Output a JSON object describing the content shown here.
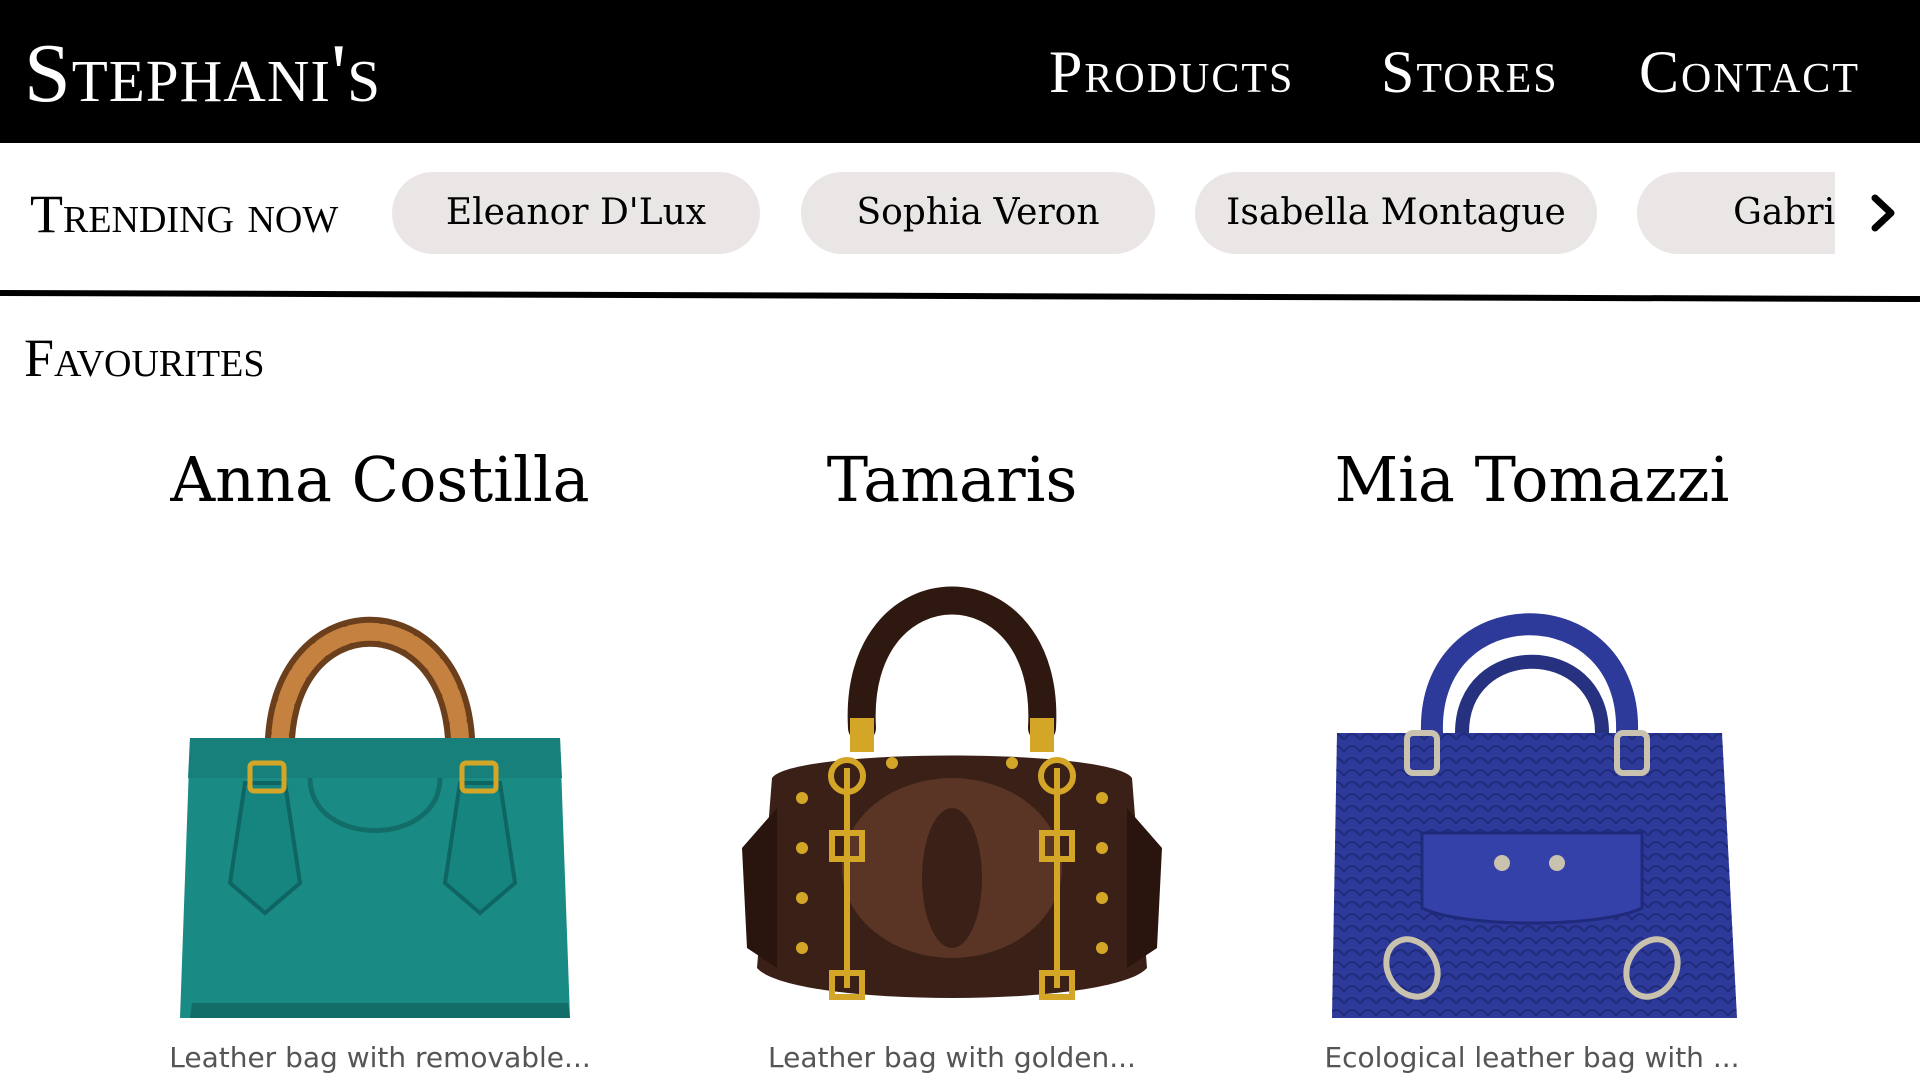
{
  "header": {
    "logo": "Stephani's",
    "nav": [
      "Products",
      "Stores",
      "Contact"
    ]
  },
  "trending": {
    "label": "Trending now",
    "chips": [
      "Eleanor D'Lux",
      "Sophia Veron",
      "Isabella Montague",
      "Gabriella"
    ],
    "next_icon": "chevron-right-icon"
  },
  "favourites": {
    "title": "Favourites",
    "items": [
      {
        "name": "Anna Costilla",
        "description": "Leather bag with removable...",
        "color": "#1a8a85",
        "image_icon": "teal-handbag-image"
      },
      {
        "name": "Tamaris",
        "description": "Leather bag with golden...",
        "color": "#3a2016",
        "image_icon": "brown-croc-handbag-image"
      },
      {
        "name": "Mia Tomazzi",
        "description": "Ecological leather bag with ...",
        "color": "#2e3a9a",
        "image_icon": "blue-snakeskin-handbag-image"
      }
    ]
  },
  "colors": {
    "header_bg": "#000000",
    "chip_bg": "#ebe6e6",
    "gold": "#d4a628"
  }
}
